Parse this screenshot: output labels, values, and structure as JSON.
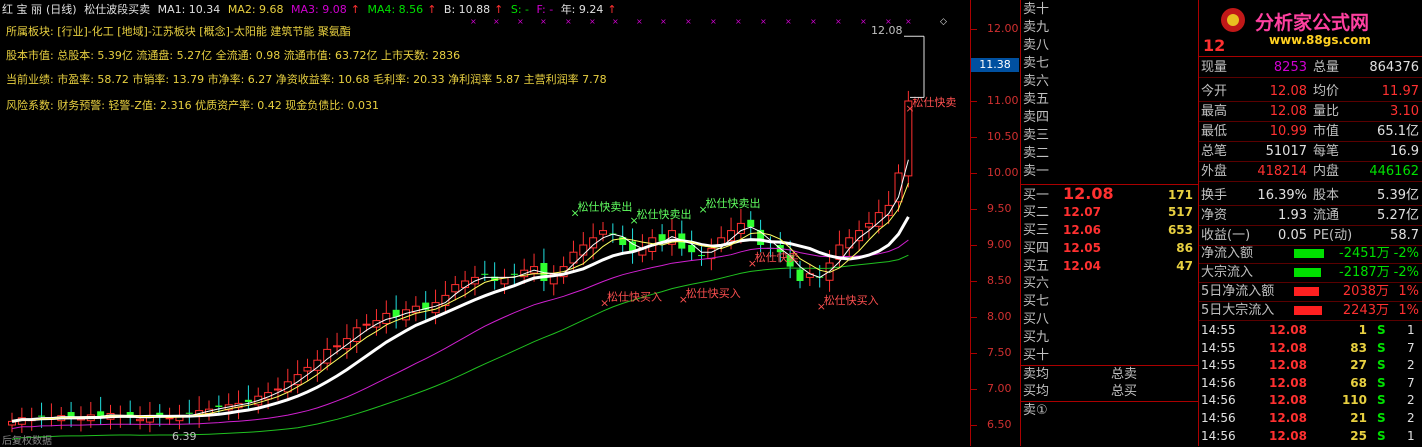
{
  "header": {
    "colors": "红 宝 丽",
    "period": "(日线)",
    "indicator": "松仕波段买卖",
    "ma1": "MA1: 10.34",
    "ma2": "MA2: 9.68",
    "ma3": "MA3: 9.08",
    "ma4": "MA4: 8.56",
    "b": "B: 10.88",
    "s": "S: -",
    "f": "F: -",
    "year": "年: 9.24"
  },
  "info": {
    "line1": "所属板块: [行业]-化工 [地域]-江苏板块 [概念]-太阳能 建筑节能 聚氨酯",
    "line2": "股本市值: 总股本: 5.39亿 流通盘: 5.27亿 全流通: 0.98 流通市值: 63.72亿 上市天数: 2836",
    "line3": "当前业绩: 市盈率: 58.72 市销率: 13.79 市净率: 6.27 净资收益率: 10.68 毛利率: 20.33 净利润率 5.87 主营利润率 7.78",
    "line4": "风险系数: 财务预警: 轻警-Z值: 2.316 优质资产率: 0.42 现金负债比: 0.031"
  },
  "chart": {
    "high_label": "12.08",
    "low_label": "6.39",
    "cursor_price": "11.38",
    "signals": {
      "sell": "松仕快卖出",
      "buy": "松仕快买入",
      "sell_short": "松仕快卖",
      "sell_cut": "松仕快卖"
    },
    "footer": "后复权数据",
    "colors": {
      "up": "#ff3030",
      "down": "#00e8e8",
      "ma1": "#ffffff",
      "ma2": "#ffff60",
      "ma3": "#d020d0",
      "ma4": "#20c020"
    }
  },
  "price_axis": {
    "ticks": [
      "12.00",
      "11.50",
      "11.00",
      "10.50",
      "10.00",
      "9.50",
      "9.00",
      "8.50",
      "8.00",
      "7.50",
      "7.00",
      "6.50"
    ]
  },
  "orderbook": {
    "sells": [
      "卖十",
      "卖九",
      "卖八",
      "卖七",
      "卖六",
      "卖五",
      "卖四",
      "卖三",
      "卖二",
      "卖一"
    ],
    "buys": [
      {
        "label": "买一",
        "price": "12.08",
        "vol": "171"
      },
      {
        "label": "买二",
        "price": "12.07",
        "vol": "517"
      },
      {
        "label": "买三",
        "price": "12.06",
        "vol": "653"
      },
      {
        "label": "买四",
        "price": "12.05",
        "vol": "86"
      },
      {
        "label": "买五",
        "price": "12.04",
        "vol": "47"
      },
      {
        "label": "买六",
        "price": "",
        "vol": ""
      },
      {
        "label": "买七",
        "price": "",
        "vol": ""
      },
      {
        "label": "买八",
        "price": "",
        "vol": ""
      },
      {
        "label": "买九",
        "price": "",
        "vol": ""
      },
      {
        "label": "买十",
        "price": "",
        "vol": ""
      }
    ],
    "sell_avg": "卖均",
    "buy_avg": "买均",
    "total_sell": "总卖",
    "total_buy": "总买",
    "sell_queue": "卖①"
  },
  "quote": {
    "logo_title": "分析家公式网",
    "logo_url": "www.88gs.com",
    "price": "12",
    "rows": [
      [
        {
          "l": "现量",
          "v": "8253",
          "c": "magenta"
        },
        {
          "l": "总量",
          "v": "864376",
          "c": "white"
        }
      ],
      [
        {
          "l": "今开",
          "v": "12.08",
          "c": "red"
        },
        {
          "l": "均价",
          "v": "11.97",
          "c": "red"
        }
      ],
      [
        {
          "l": "最高",
          "v": "12.08",
          "c": "red"
        },
        {
          "l": "量比",
          "v": "3.10",
          "c": "red"
        }
      ],
      [
        {
          "l": "最低",
          "v": "10.99",
          "c": "red"
        },
        {
          "l": "市值",
          "v": "65.1亿",
          "c": "white"
        }
      ],
      [
        {
          "l": "总笔",
          "v": "51017",
          "c": "white"
        },
        {
          "l": "每笔",
          "v": "16.9",
          "c": "white"
        }
      ],
      [
        {
          "l": "外盘",
          "v": "418214",
          "c": "red"
        },
        {
          "l": "内盘",
          "v": "446162",
          "c": "green"
        }
      ],
      [
        {
          "l": "换手",
          "v": "16.39%",
          "c": "white"
        },
        {
          "l": "股本",
          "v": "5.39亿",
          "c": "white"
        }
      ],
      [
        {
          "l": "净资",
          "v": "1.93",
          "c": "white"
        },
        {
          "l": "流通",
          "v": "5.27亿",
          "c": "white"
        }
      ],
      [
        {
          "l": "收益(一)",
          "v": "0.05",
          "c": "white"
        },
        {
          "l": "PE(动)",
          "v": "58.7",
          "c": "white"
        }
      ]
    ],
    "flows": [
      {
        "l": "净流入额",
        "v": "-2451万",
        "p": "-2%",
        "c": "green",
        "bar": 0.5
      },
      {
        "l": "大宗流入",
        "v": "-2187万",
        "p": "-2%",
        "c": "green",
        "bar": 0.45
      },
      {
        "l": "5日净流入额",
        "v": "2038万",
        "p": "1%",
        "c": "red",
        "bar": 0.42
      },
      {
        "l": "5日大宗流入",
        "v": "2243万",
        "p": "1%",
        "c": "red",
        "bar": 0.46
      }
    ],
    "ticks": [
      {
        "t": "14:55",
        "p": "12.08",
        "v": "1",
        "s": "S",
        "n": "1"
      },
      {
        "t": "14:55",
        "p": "12.08",
        "v": "83",
        "s": "S",
        "n": "7"
      },
      {
        "t": "14:55",
        "p": "12.08",
        "v": "27",
        "s": "S",
        "n": "2"
      },
      {
        "t": "14:56",
        "p": "12.08",
        "v": "68",
        "s": "S",
        "n": "7"
      },
      {
        "t": "14:56",
        "p": "12.08",
        "v": "110",
        "s": "S",
        "n": "2"
      },
      {
        "t": "14:56",
        "p": "12.08",
        "v": "21",
        "s": "S",
        "n": "2"
      },
      {
        "t": "14:56",
        "p": "12.08",
        "v": "25",
        "s": "S",
        "n": "1"
      }
    ]
  }
}
